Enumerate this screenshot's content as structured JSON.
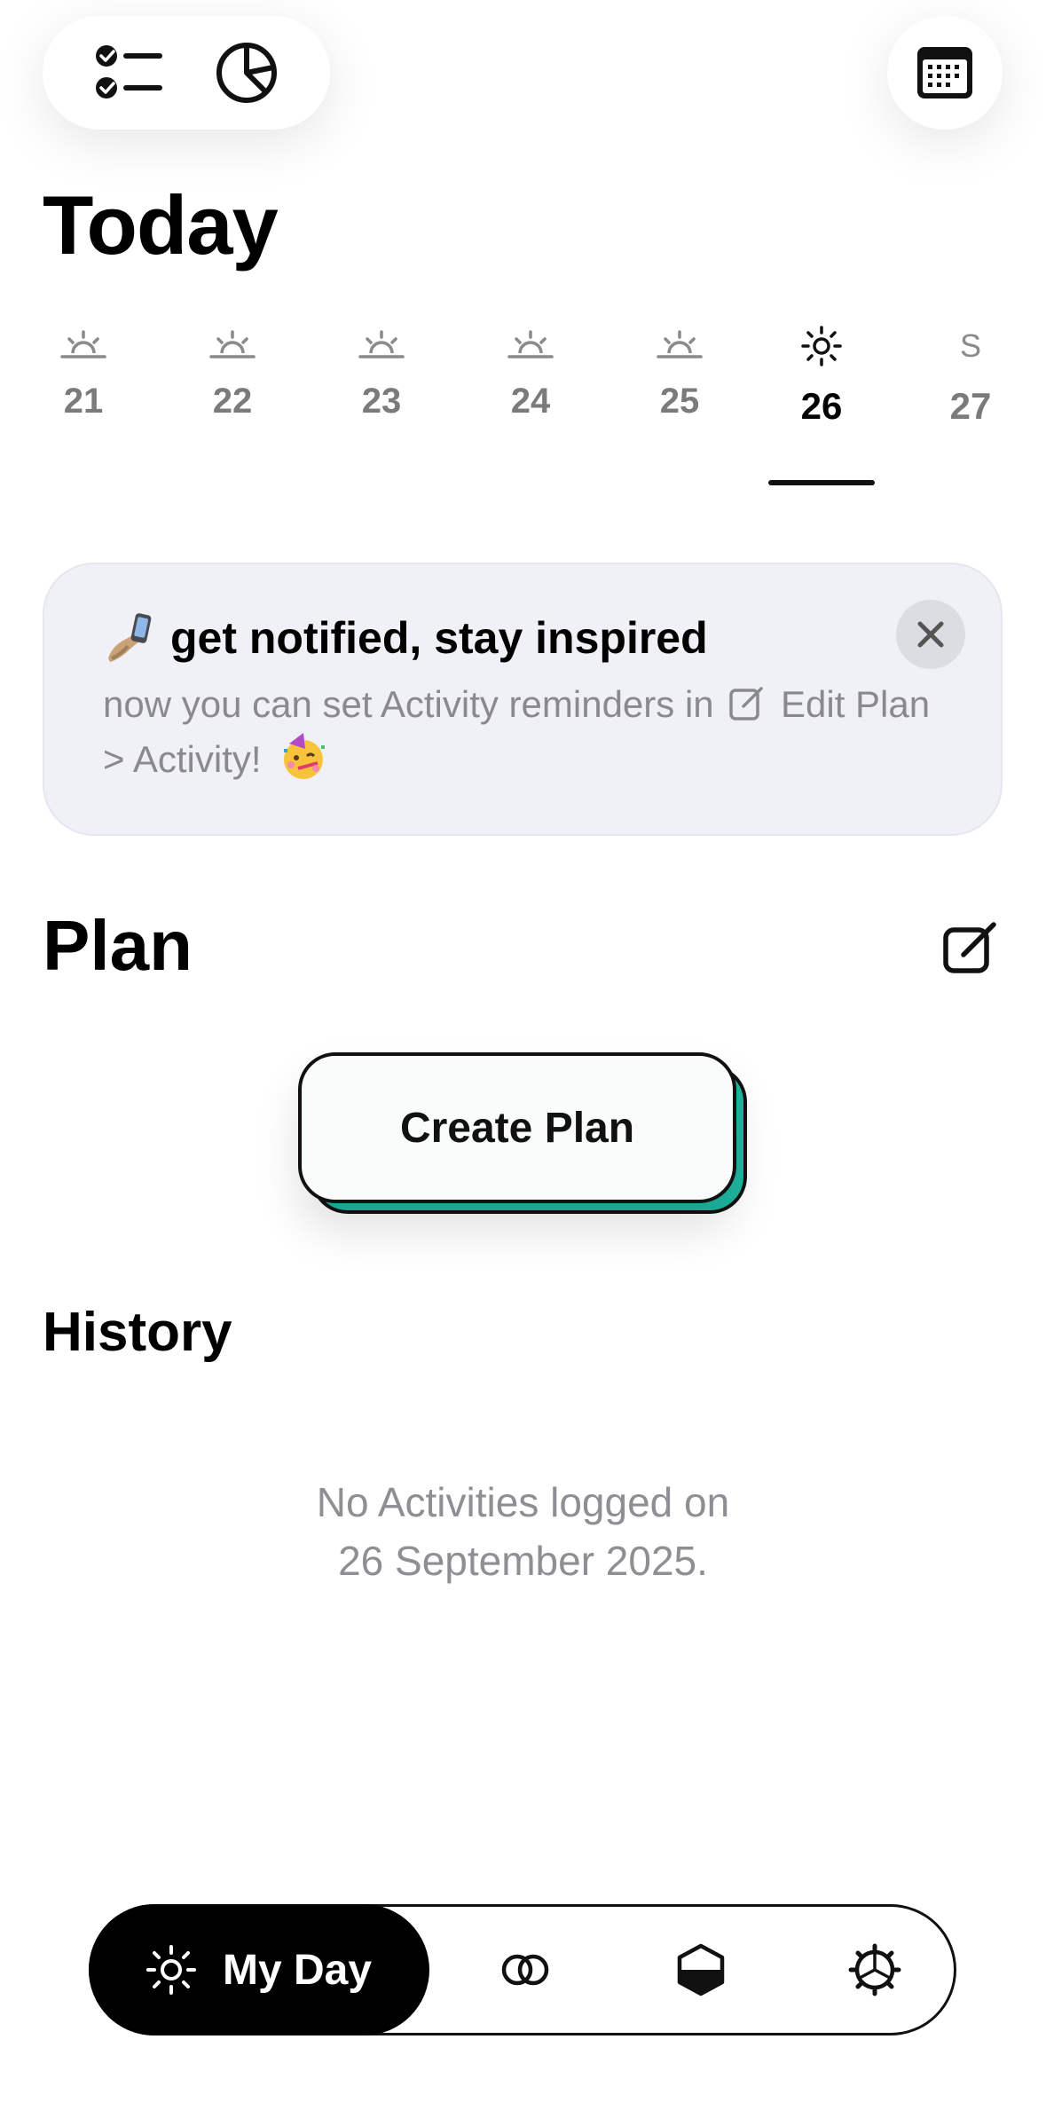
{
  "header": {
    "left_icons": [
      "checklist-icon",
      "pie-chart-icon"
    ],
    "right_icon": "calendar-icon",
    "title": "Today"
  },
  "week": {
    "days": [
      {
        "label": "21",
        "icon": "sunrise-icon"
      },
      {
        "label": "22",
        "icon": "sunrise-icon"
      },
      {
        "label": "23",
        "icon": "sunrise-icon"
      },
      {
        "label": "24",
        "icon": "sunrise-icon"
      },
      {
        "label": "25",
        "icon": "sunrise-icon"
      },
      {
        "label": "26",
        "icon": "sun-icon",
        "selected": true
      },
      {
        "label": "27",
        "letter": "S"
      }
    ]
  },
  "banner": {
    "title": "get notified, stay inspired",
    "body_prefix": "now you can set Activity reminders in",
    "body_link": "Edit Plan > Activity!"
  },
  "plan": {
    "title": "Plan",
    "create_label": "Create Plan"
  },
  "history": {
    "title": "History",
    "empty_line1": "No Activities logged on",
    "empty_line2": "26 September 2025."
  },
  "nav": {
    "active_label": "My Day",
    "items": [
      "my-day",
      "circles-icon",
      "hexagon-icon",
      "gear-icon"
    ]
  },
  "colors": {
    "accent_teal": "#1fb8a1",
    "banner_bg": "#f0f1f6",
    "muted_text": "#8e8e93"
  }
}
